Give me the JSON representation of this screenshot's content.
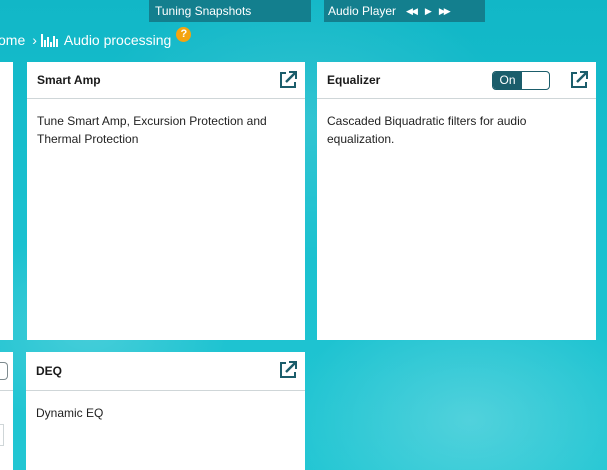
{
  "topbar": {
    "snapshots_label": "Tuning Snapshots",
    "player_label": "Audio Player"
  },
  "breadcrumb": {
    "home": "ome",
    "separator": "›",
    "current": "Audio processing",
    "help": "?"
  },
  "cards": {
    "smart_amp": {
      "title": "Smart Amp",
      "description": "Tune Smart Amp, Excursion Protection and Thermal Protection"
    },
    "equalizer": {
      "title": "Equalizer",
      "description": "Cascaded Biquadratic filters for audio equalization.",
      "toggle_label": "On"
    },
    "deq": {
      "title": "DEQ",
      "description": "Dynamic EQ"
    }
  }
}
